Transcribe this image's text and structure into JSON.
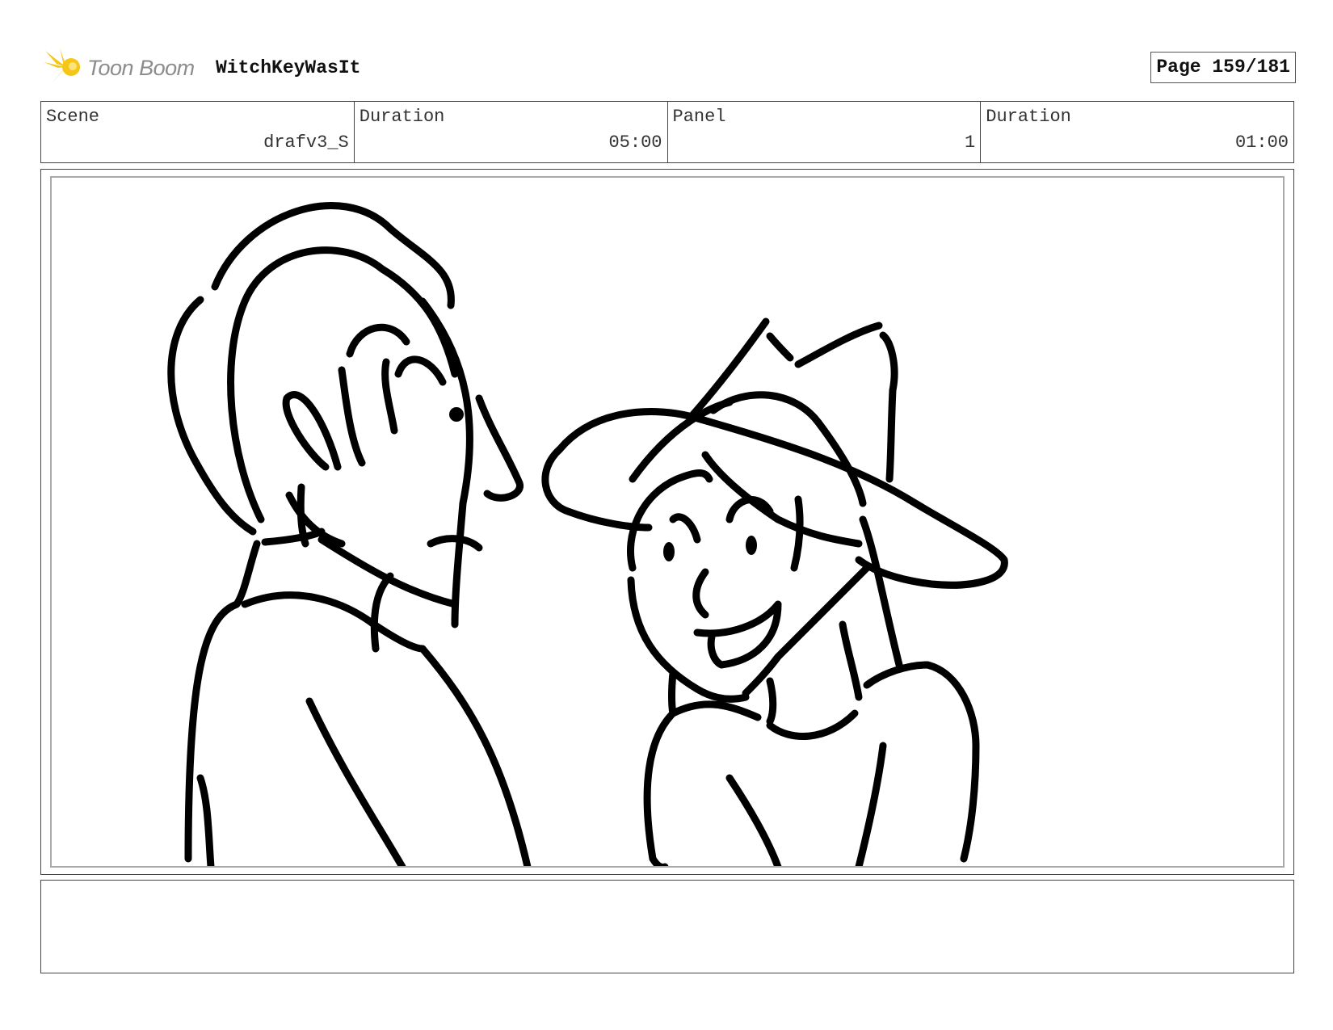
{
  "header": {
    "logo_text": "Toon Boom",
    "logo_icon": "toon-boom-star-icon",
    "project_title": "WitchKeyWasIt",
    "page_label": "Page 159/181"
  },
  "info": {
    "scene_label": "Scene",
    "scene_value": "drafv3_S",
    "duration_label": "Duration",
    "duration_value": "05:00",
    "panel_label": "Panel",
    "panel_value": "1",
    "panel_duration_label": "Duration",
    "panel_duration_value": "01:00"
  },
  "notes": {
    "text": ""
  },
  "colors": {
    "logo_yellow": "#f5c518",
    "logo_text": "#8c8c8c",
    "border": "#444444",
    "sketch_line": "#000000"
  }
}
